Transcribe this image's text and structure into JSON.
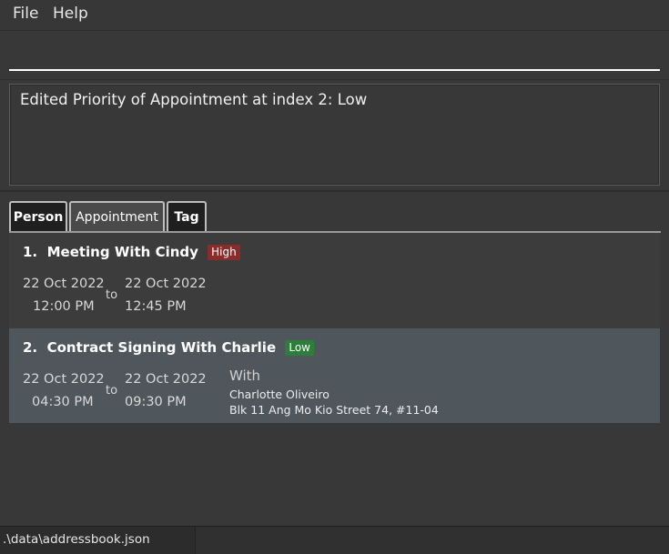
{
  "menu": {
    "file": "File",
    "help": "Help"
  },
  "command": {
    "value": ""
  },
  "result": {
    "text": "Edited Priority of Appointment at index 2: Low"
  },
  "tabs": [
    {
      "label": "Person",
      "active": false
    },
    {
      "label": "Appointment",
      "active": true
    },
    {
      "label": "Tag",
      "active": false
    }
  ],
  "appointments": [
    {
      "index": "1.",
      "title": "Meeting With Cindy",
      "priority": "High",
      "start_date": "22 Oct 2022",
      "start_time": "12:00 PM",
      "to": "to",
      "end_date": "22 Oct 2022",
      "end_time": "12:45 PM"
    },
    {
      "index": "2.",
      "title": "Contract Signing With Charlie",
      "priority": "Low",
      "start_date": "22 Oct 2022",
      "start_time": "04:30 PM",
      "to": "to",
      "end_date": "22 Oct 2022",
      "end_time": "09:30 PM",
      "with_label": "With",
      "with_name": "Charlotte Oliveiro",
      "with_address": "Blk 11 Ang Mo Kio Street 74, #11-04"
    }
  ],
  "status": {
    "path": ".\\data\\addressbook.json"
  },
  "colors": {
    "priority_high": "#8b2c2c",
    "priority_low": "#2d7e3a",
    "selected_card": "#50575c"
  }
}
